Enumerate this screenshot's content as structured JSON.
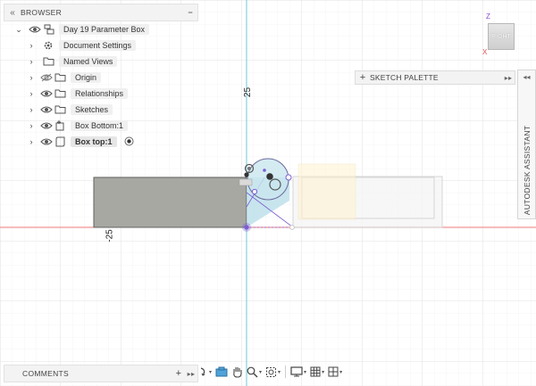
{
  "browser": {
    "title": "BROWSER",
    "collapse_glyph": "«",
    "minimize_glyph": "−",
    "root": "Day 19 Parameter Box",
    "items": [
      {
        "label": "Document Settings",
        "icon": "gear-icon"
      },
      {
        "label": "Named Views",
        "icon": "folder-icon"
      },
      {
        "label": "Origin",
        "icon": "folder-icon",
        "eye": "hidden"
      },
      {
        "label": "Relationships",
        "icon": "folder-icon",
        "eye": "visible"
      },
      {
        "label": "Sketches",
        "icon": "folder-icon",
        "eye": "visible"
      },
      {
        "label": "Box Bottom:1",
        "icon": "body-link-icon",
        "eye": "visible"
      },
      {
        "label": "Box top:1",
        "icon": "body-icon",
        "eye": "visible",
        "selected": true
      }
    ]
  },
  "sketch_palette": {
    "label": "SKETCH PALETTE",
    "plus": "+",
    "arrows": "▸▸"
  },
  "assistant": {
    "label": "AUTODESK ASSISTANT",
    "arrows": "◂◂"
  },
  "comments": {
    "label": "COMMENTS",
    "plus": "+",
    "arrows": "▸▸"
  },
  "viewcube": {
    "face": "RIGHT",
    "z": "Z",
    "x": "X"
  },
  "dimensions": {
    "vertical": "25",
    "horizontal": "-25"
  },
  "colors": {
    "accent": "#7b5fd1",
    "axis_red": "#f07a7a",
    "axis_cyan": "#6fc9d6",
    "body_gray": "#a8a8a3",
    "profile_blue": "#b6dce8",
    "ghost_yellow": "#fff3cf"
  },
  "toolbar": {
    "icons": [
      "orbit-icon",
      "look-at-icon",
      "pan-icon",
      "zoom-icon",
      "fit-icon",
      "display-settings-icon",
      "grid-icon",
      "viewports-icon"
    ]
  }
}
